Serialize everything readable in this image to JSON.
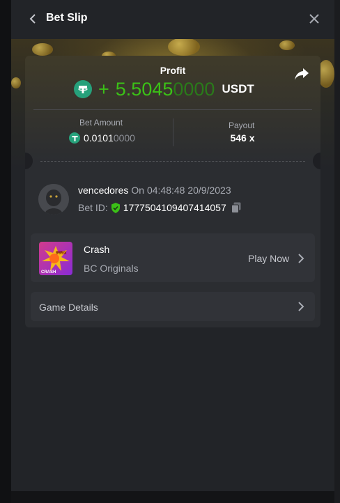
{
  "header": {
    "title": "Bet Slip"
  },
  "profit": {
    "label": "Profit",
    "sign": "+",
    "value_main": "5.5045",
    "value_dim": "0000",
    "unit": "USDT"
  },
  "bet_amount": {
    "label": "Bet Amount",
    "value_main": "0.0101",
    "value_dim": "0000"
  },
  "payout": {
    "label": "Payout",
    "value": "546 x"
  },
  "user": {
    "name": "vencedores",
    "timestamp": "On 04:48:48 20/9/2023",
    "bet_id_label": "Bet ID:",
    "bet_id": "1777504109407414057"
  },
  "game": {
    "name": "Crash",
    "provider": "BC Originals",
    "action_label": "Play Now",
    "thumb_badge": "999x",
    "thumb_text": "CRASH"
  },
  "details": {
    "label": "Game Details"
  },
  "colors": {
    "profit_green": "#3bc117",
    "tether_green": "#26a17b",
    "panel_bg": "#222428",
    "card_bg": "#2b2d31"
  },
  "icons": [
    "back-arrow-icon",
    "close-icon",
    "share-icon",
    "tether-icon",
    "shield-check-icon",
    "copy-icon",
    "chevron-right-icon"
  ]
}
